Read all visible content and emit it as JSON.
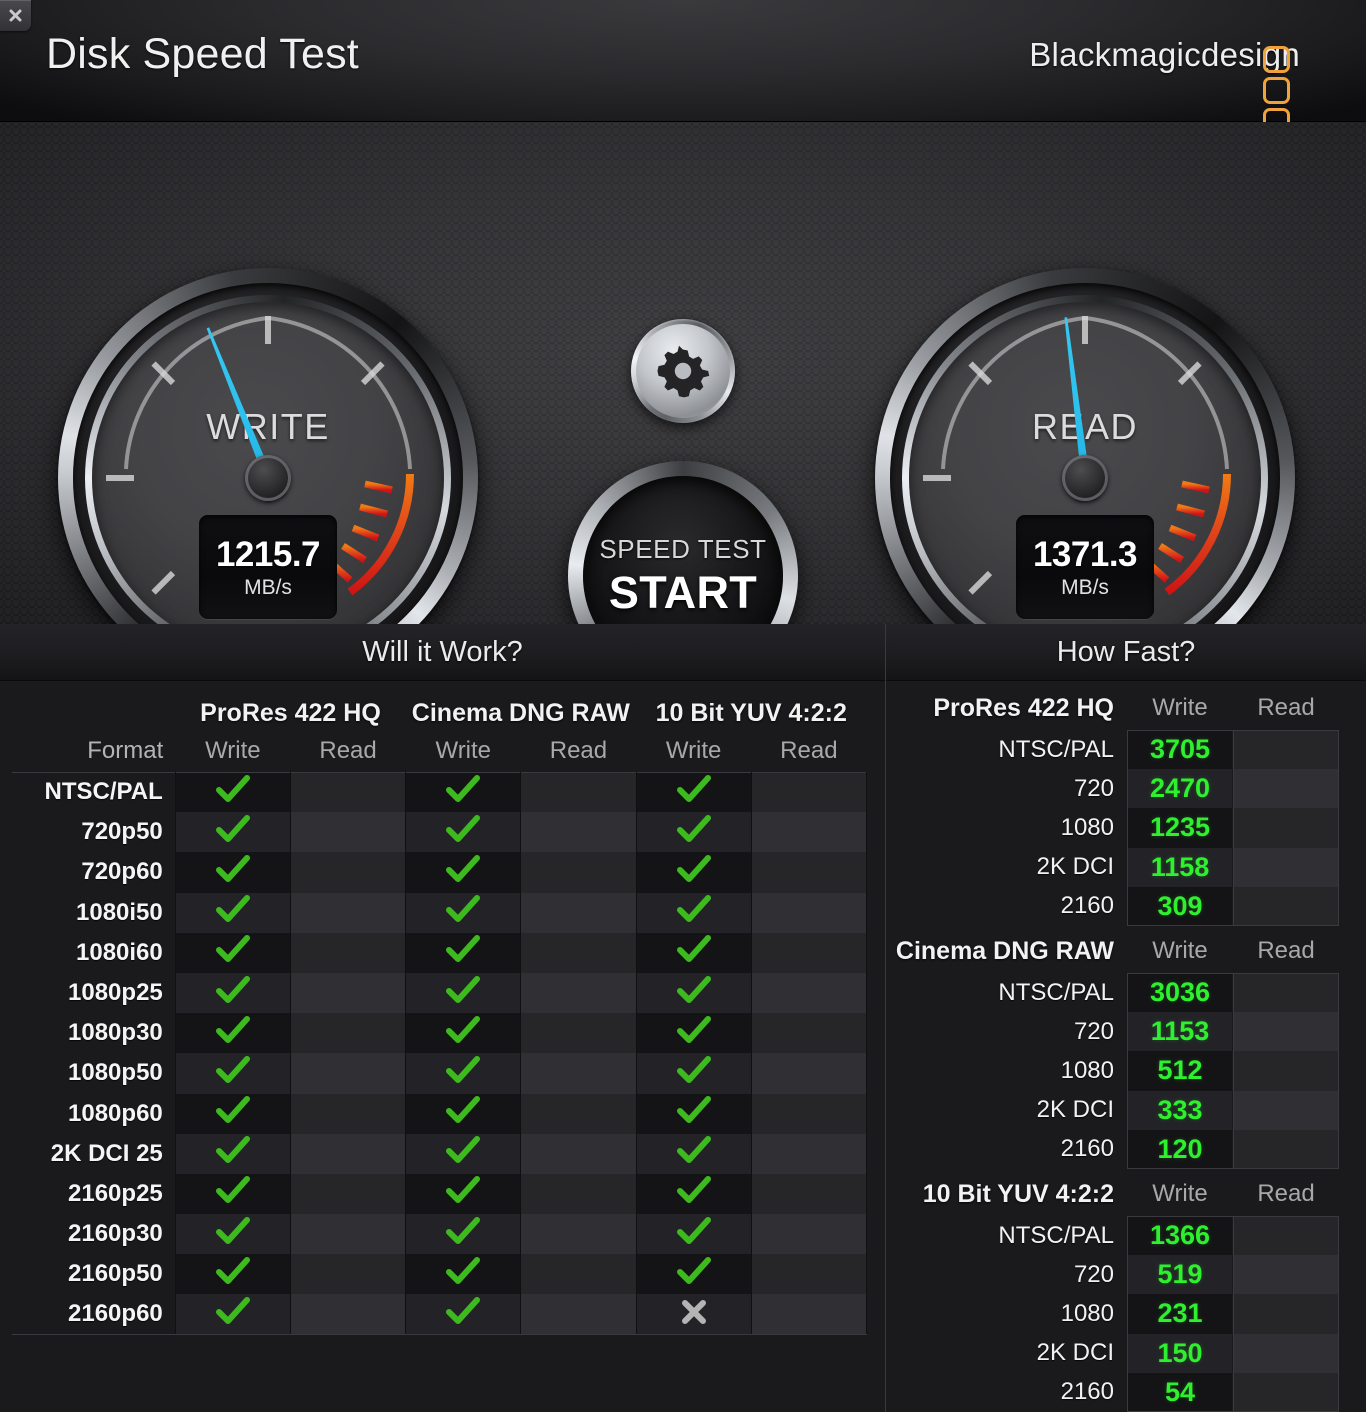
{
  "window": {
    "title": "Disk Speed Test",
    "close_icon": "close-icon",
    "brand": "Blackmagicdesign"
  },
  "gauges": {
    "write": {
      "label": "WRITE",
      "value": "1215.7",
      "unit": "MB/s",
      "needle_deg": -22
    },
    "read": {
      "label": "READ",
      "value": "1371.3",
      "unit": "MB/s",
      "needle_deg": -7
    },
    "settings_icon": "gear-icon",
    "start_button": {
      "top_label": "SPEED TEST",
      "main_label": "START"
    }
  },
  "colors": {
    "needle": "#2ec0ee",
    "brand_accent": "#f0a33a",
    "check_green": "#3dbb1e",
    "value_green": "#2ef02e",
    "x_gray": "#b4b4b4"
  },
  "will_it_work": {
    "title": "Will it Work?",
    "format_header": "Format",
    "codec_groups": [
      "ProRes 422 HQ",
      "Cinema DNG RAW",
      "10 Bit YUV 4:2:2"
    ],
    "sub_headers": [
      "Write",
      "Read"
    ],
    "rows": [
      {
        "format": "NTSC/PAL",
        "cells": [
          "check",
          "",
          "check",
          "",
          "check",
          ""
        ]
      },
      {
        "format": "720p50",
        "cells": [
          "check",
          "",
          "check",
          "",
          "check",
          ""
        ]
      },
      {
        "format": "720p60",
        "cells": [
          "check",
          "",
          "check",
          "",
          "check",
          ""
        ]
      },
      {
        "format": "1080i50",
        "cells": [
          "check",
          "",
          "check",
          "",
          "check",
          ""
        ]
      },
      {
        "format": "1080i60",
        "cells": [
          "check",
          "",
          "check",
          "",
          "check",
          ""
        ]
      },
      {
        "format": "1080p25",
        "cells": [
          "check",
          "",
          "check",
          "",
          "check",
          ""
        ]
      },
      {
        "format": "1080p30",
        "cells": [
          "check",
          "",
          "check",
          "",
          "check",
          ""
        ]
      },
      {
        "format": "1080p50",
        "cells": [
          "check",
          "",
          "check",
          "",
          "check",
          ""
        ]
      },
      {
        "format": "1080p60",
        "cells": [
          "check",
          "",
          "check",
          "",
          "check",
          ""
        ]
      },
      {
        "format": "2K DCI 25",
        "cells": [
          "check",
          "",
          "check",
          "",
          "check",
          ""
        ]
      },
      {
        "format": "2160p25",
        "cells": [
          "check",
          "",
          "check",
          "",
          "check",
          ""
        ]
      },
      {
        "format": "2160p30",
        "cells": [
          "check",
          "",
          "check",
          "",
          "check",
          ""
        ]
      },
      {
        "format": "2160p50",
        "cells": [
          "check",
          "",
          "check",
          "",
          "check",
          ""
        ]
      },
      {
        "format": "2160p60",
        "cells": [
          "check",
          "",
          "check",
          "",
          "x",
          ""
        ]
      }
    ]
  },
  "how_fast": {
    "title": "How Fast?",
    "write_header": "Write",
    "read_header": "Read",
    "groups": [
      {
        "name": "ProRes 422 HQ",
        "rows": [
          {
            "label": "NTSC/PAL",
            "write": "3705",
            "read": ""
          },
          {
            "label": "720",
            "write": "2470",
            "read": ""
          },
          {
            "label": "1080",
            "write": "1235",
            "read": ""
          },
          {
            "label": "2K DCI",
            "write": "1158",
            "read": ""
          },
          {
            "label": "2160",
            "write": "309",
            "read": ""
          }
        ]
      },
      {
        "name": "Cinema DNG RAW",
        "rows": [
          {
            "label": "NTSC/PAL",
            "write": "3036",
            "read": ""
          },
          {
            "label": "720",
            "write": "1153",
            "read": ""
          },
          {
            "label": "1080",
            "write": "512",
            "read": ""
          },
          {
            "label": "2K DCI",
            "write": "333",
            "read": ""
          },
          {
            "label": "2160",
            "write": "120",
            "read": ""
          }
        ]
      },
      {
        "name": "10 Bit YUV 4:2:2",
        "rows": [
          {
            "label": "NTSC/PAL",
            "write": "1366",
            "read": ""
          },
          {
            "label": "720",
            "write": "519",
            "read": ""
          },
          {
            "label": "1080",
            "write": "231",
            "read": ""
          },
          {
            "label": "2K DCI",
            "write": "150",
            "read": ""
          },
          {
            "label": "2160",
            "write": "54",
            "read": ""
          }
        ]
      }
    ]
  },
  "chart_data": {
    "type": "table",
    "title": "How Fast? — measured throughput (MB/s)",
    "categories": [
      "NTSC/PAL",
      "720",
      "1080",
      "2K DCI",
      "2160"
    ],
    "series": [
      {
        "name": "ProRes 422 HQ Write",
        "values": [
          3705,
          2470,
          1235,
          1158,
          309
        ]
      },
      {
        "name": "Cinema DNG RAW Write",
        "values": [
          3036,
          1153,
          512,
          333,
          120
        ]
      },
      {
        "name": "10 Bit YUV 4:2:2 Write",
        "values": [
          1366,
          519,
          231,
          150,
          54
        ]
      }
    ],
    "ylabel": "MB/s",
    "gauge_readings": {
      "write_mbs": 1215.7,
      "read_mbs": 1371.3
    }
  }
}
